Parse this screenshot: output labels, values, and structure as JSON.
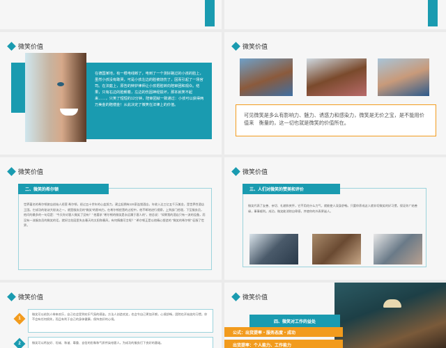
{
  "slides": {
    "s1": {
      "title": "微笑价值",
      "paragraph": "在德国某地，有一根电线断了，电到了一个测好路过的小孩的脸上，虽然小孩没有敢哭，可是小孩左边的脸被烧伤了，因而引起了一场官司。在法庭上，原告的辩护律师让小孩把脸转向陪审团和观众。结果，只有右边的脸朝着，左边的伤因神经损坏，那本就笑不起来……，只笑了短短的12分钟，陪审团就一致通过：小孩可以获得两万美金的赔偿金！从此决定了微笑在法律上的价值。"
    },
    "s2": {
      "title": "微笑价值",
      "quote": "可见微笑是多么有影响力、魅力、诱惑力和感染力，微笑是无价之宝，是不能用价值来　衡量的，这一切也就是微笑的价值所在。"
    },
    "s3": {
      "title": "微笑价值",
      "section": "二、微笑的希尔顿",
      "body": "世界著名的希尔顿旅店创始人经营 希尔顿，经过五十余年的心血努力，建立起拥有115家连锁酒店，年收入达三亿五千万美金，是世界性酒店王国。它成功的秘诀大秘诀之一，就是服务员的“微笑”的影响力。在希尔顿经营的过程中，他不断地进行视察，上到部门经理，下至服务员，他问的最多的一句话是：“今天你对客人微笑了没有？” 他要求 “希尔顿的微笑是永远属于客人的”，他总说：“如果我的酒店只有一流的设备，而没有一流服务员的微笑的话，就好比花园里失去春天的太阳和春风，有何情趣可言呢？” 希尔顿正是以他精心塑造的 “微笑的希尔顿” 征服了世界。"
    },
    "s4": {
      "title": "微笑价值",
      "section": "三、人们对微笑的赞美和评价",
      "body": "微笑代表了友善、亲切、礼貌和关怀，它不用花什么力气，就能使人深身舒畅。只要你养成这人就非切微笑的好习惯，保证你广结善缘，事事顺利。成功，微笑能消除自卑感，并使你的外表更迷人。"
    },
    "s5": {
      "title": "微笑价值",
      "items": [
        {
          "num": "1",
          "text": "微笑可以给别人带来欢乐，自己也会受到欢乐气氛的感染。方法人创造欢笑，也会令自己更加开朗，心境舒畅，团院也开始笑的习惯，你不会有任何损失，而且有利于自己的身体健康，保持良好的心境。"
        },
        {
          "num": "2",
          "text": "微笑可以将友好、坦诚、和谐、尊重、自信的形象和气质传染给客人，为成功的服务打下良好的基础。"
        }
      ]
    },
    "s6": {
      "title": "微笑价值",
      "section": "四、微笑对工作的益处",
      "formula1": "公式：出货提率・服务态度・成功",
      "formula2": "出货提率：个人能力、工作能力"
    }
  },
  "colors": {
    "accent": "#1a9bb0",
    "orange": "#f29b1d",
    "dark": "#2b5a63"
  }
}
